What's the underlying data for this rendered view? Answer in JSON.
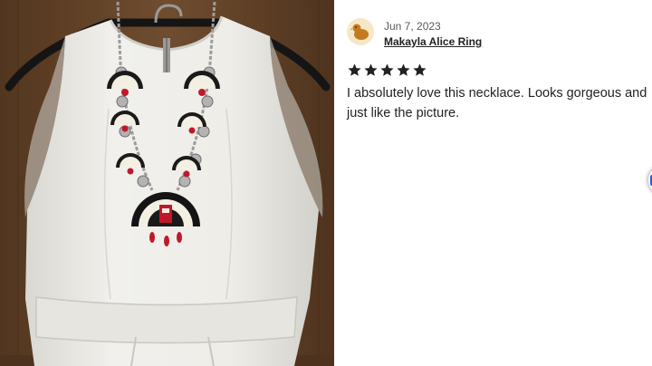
{
  "photo": {
    "subject": "white sleeveless dress with squash blossom necklace on hanger"
  },
  "review": {
    "date": "Jun 7, 2023",
    "reviewer_name": "Makayla Alice Ring",
    "rating": 5,
    "rating_max": 5,
    "text": "I absolutely love this necklace. Looks gorgeous and just like the picture.",
    "avatar_icon": "duck-avatar-icon",
    "star_color": "#222222"
  },
  "colors": {
    "wood": "#6b4a2f",
    "dress": "#ecebe6",
    "accent_blue": "#2a5cd8"
  }
}
